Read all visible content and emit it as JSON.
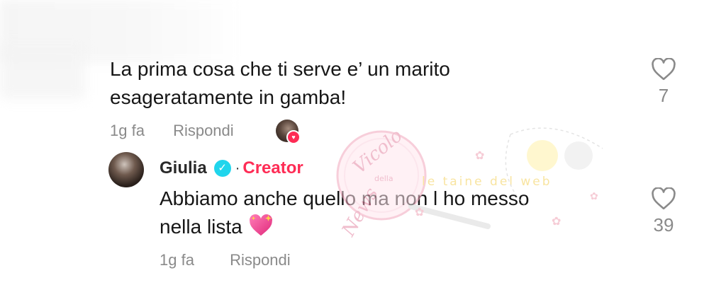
{
  "comment": {
    "text_line1": "La prima cosa che ti serve e’ un marito",
    "text_line2": "esageratamente in gamba!",
    "time": "1g fa",
    "reply_label": "Rispondi",
    "likes": "7"
  },
  "reply": {
    "username": "Giulia",
    "badge_label": "Creator",
    "separator": "·",
    "text_line1": "Abbiamo anche quello ma non l ho messo",
    "text_line2": "nella lista",
    "time": "1g fa",
    "reply_label": "Rispondi",
    "likes": "39"
  },
  "watermark": {
    "text1": "Vicolo",
    "text2": "della",
    "text3": "News",
    "text4": "le taine del web"
  },
  "colors": {
    "accent": "#fe2c55",
    "verified": "#20d5ec",
    "muted": "#8a8a8a",
    "text": "#161616"
  },
  "icons": {
    "like": "heart-outline-icon",
    "verified": "verified-check-icon",
    "liked_by_creator": "heart-badge-icon",
    "emoji": "sparkling-heart-emoji"
  }
}
